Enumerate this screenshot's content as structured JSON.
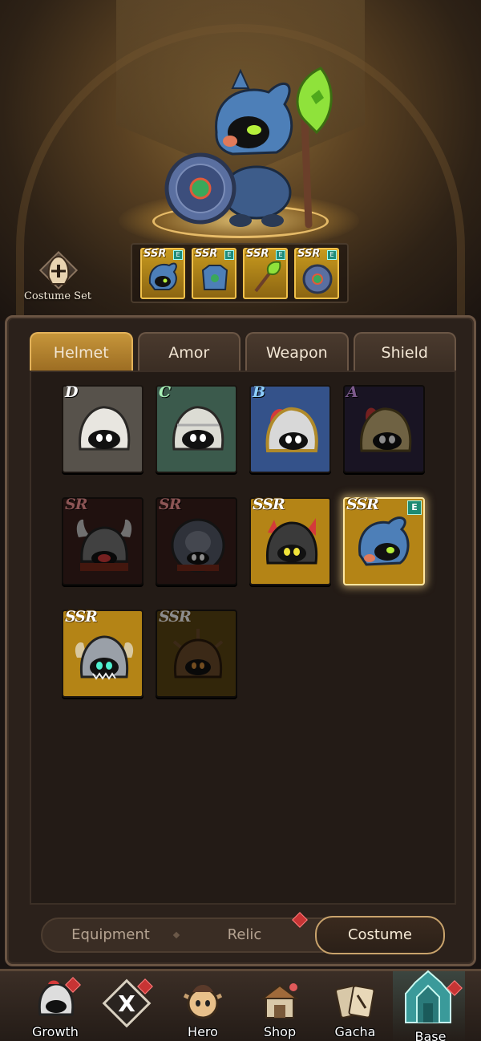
{
  "costume_set": {
    "label": "Costume Set",
    "icon": "helmet-icon"
  },
  "equipped": [
    {
      "rank": "SSR",
      "badge": "E",
      "icon": "helmet-icon"
    },
    {
      "rank": "SSR",
      "badge": "E",
      "icon": "armor-icon"
    },
    {
      "rank": "SSR",
      "badge": "E",
      "icon": "axe-icon"
    },
    {
      "rank": "SSR",
      "badge": "E",
      "icon": "shield-icon"
    }
  ],
  "tabs": [
    {
      "label": "Helmet",
      "active": true
    },
    {
      "label": "Amor",
      "active": false
    },
    {
      "label": "Weapon",
      "active": false
    },
    {
      "label": "Shield",
      "active": false
    }
  ],
  "items": [
    {
      "rank": "D",
      "rank_color": "#ffffff",
      "bg": "#57524b"
    },
    {
      "rank": "C",
      "rank_color": "#a8f0b8",
      "bg": "#3b5a4c"
    },
    {
      "rank": "B",
      "rank_color": "#8fd0ff",
      "bg": "#34528a"
    },
    {
      "rank": "A",
      "rank_color": "#e1a4ff",
      "bg": "#2e2440"
    },
    {
      "rank": "SR",
      "rank_color": "#ff9a9a",
      "bg": "#3a1f1c"
    },
    {
      "rank": "SR",
      "rank_color": "#ff9a9a",
      "bg": "#3a1f1c"
    },
    {
      "rank": "SSR",
      "rank_color": "#ffffff",
      "bg": "#b48416"
    },
    {
      "rank": "SSR",
      "rank_color": "#ffffff",
      "bg": "#b48416",
      "badge": "E"
    },
    {
      "rank": "SSR",
      "rank_color": "#ffffff",
      "bg": "#b48416"
    },
    {
      "rank": "SSR",
      "rank_color": "#ffffff",
      "bg": "#5a4512"
    }
  ],
  "modes": {
    "equipment": "Equipment",
    "relic": "Relic",
    "costume": "Costume"
  },
  "nav": [
    {
      "label": "Growth",
      "icon": "knight-icon"
    },
    {
      "label": "X",
      "icon": "x-battle-icon"
    },
    {
      "label": "Hero",
      "icon": "hero-icon"
    },
    {
      "label": "Shop",
      "icon": "shop-icon"
    },
    {
      "label": "Gacha",
      "icon": "cards-icon"
    },
    {
      "label": "Base",
      "icon": "castle-icon"
    }
  ],
  "colors": {
    "accent_gold": "#c6953a",
    "panel_bg": "#2b211b",
    "alert_red": "#c73434",
    "equip_badge": "#1d8a72"
  }
}
